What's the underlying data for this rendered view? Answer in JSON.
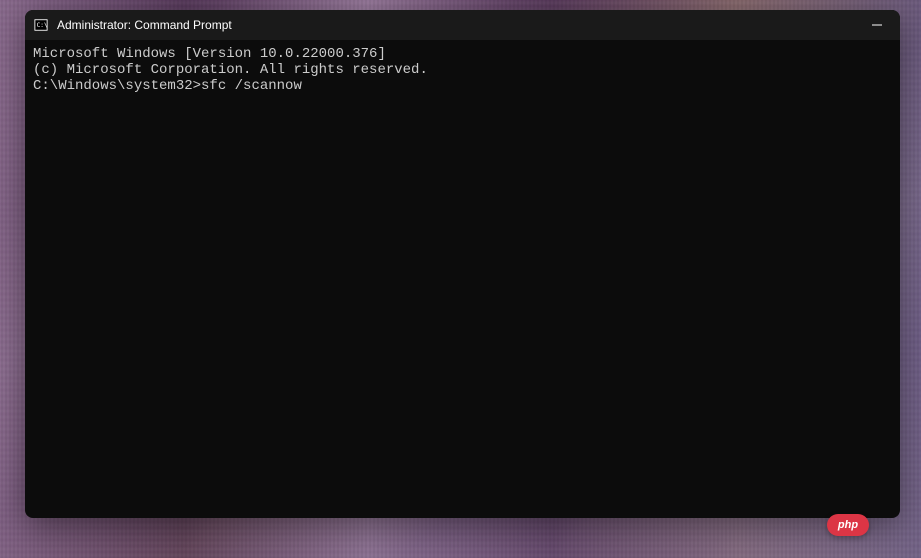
{
  "window": {
    "title": "Administrator: Command Prompt"
  },
  "terminal": {
    "line1": "Microsoft Windows [Version 10.0.22000.376]",
    "line2": "(c) Microsoft Corporation. All rights reserved.",
    "line3": "",
    "prompt": "C:\\Windows\\system32>",
    "command": "sfc /scannow"
  },
  "watermark": {
    "text": "php"
  }
}
